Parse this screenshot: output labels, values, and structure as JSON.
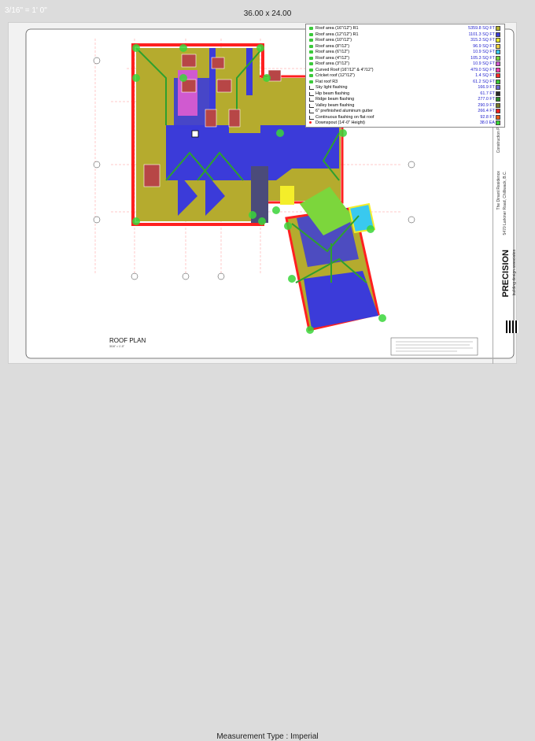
{
  "viewer": {
    "scale_label": "3/16\" = 1' 0\"",
    "sheet_size": "36.00 x 24.00",
    "measurement_type": "Measurement Type : Imperial"
  },
  "legend": [
    {
      "label": "Roof area (16\"/12\") R1",
      "value": "5359.8 SQ FT",
      "color": "#b5b230",
      "icon": "area"
    },
    {
      "label": "Roof area (12\"/12\") R1",
      "value": "1101.3 SQ FT",
      "color": "#3b3bd9",
      "icon": "area"
    },
    {
      "label": "Roof area (10\"/12\")",
      "value": "315.3 SQ FT",
      "color": "#e8e826",
      "icon": "area"
    },
    {
      "label": "Roof area (8\"/12\")",
      "value": "96.9 SQ FT",
      "color": "#f0d040",
      "icon": "area"
    },
    {
      "label": "Roof area (6\"/12\")",
      "value": "10.9 SQ FT",
      "color": "#39c9ef",
      "icon": "area"
    },
    {
      "label": "Roof area (4\"/12\")",
      "value": "105.3 SQ FT",
      "color": "#7cd63c",
      "icon": "area"
    },
    {
      "label": "Roof area (3\"/12\")",
      "value": "10.9 SQ FT",
      "color": "#d05ad0",
      "icon": "area"
    },
    {
      "label": "Curved Roof (16\"/12\" & 4\"/12\")",
      "value": "479.0 SQ FT",
      "color": "#ff3fb0",
      "icon": "area"
    },
    {
      "label": "Cricket roof (12\"/12\")",
      "value": "1.4 SQ FT",
      "color": "#ff2a2a",
      "icon": "area"
    },
    {
      "label": "Flat roof R3",
      "value": "61.2 SQ FT",
      "color": "#3ac93a",
      "icon": "area"
    },
    {
      "label": "Sky light flashing",
      "value": "166.9 FT",
      "color": "#6a6ad0",
      "icon": "line"
    },
    {
      "label": "Hip beam flashing",
      "value": "61.7 FT",
      "color": "#2a2a2a",
      "icon": "line"
    },
    {
      "label": "Ridge beam flashing",
      "value": "277.0 FT",
      "color": "#2a8a2a",
      "icon": "line"
    },
    {
      "label": "Valley beam  flashing",
      "value": "290.9 FT",
      "color": "#7a7a2a",
      "icon": "line"
    },
    {
      "label": "6\" prefinished aluminum gutter",
      "value": "266.4 FT",
      "color": "#ff2020",
      "icon": "line"
    },
    {
      "label": "Continuous flashing on flat roof",
      "value": "92.8 FT",
      "color": "#e85a1a",
      "icon": "line"
    },
    {
      "label": "Downspout (14'-0\" Height)",
      "value": "38.0 EA",
      "color": "#3ad63a",
      "icon": "dot"
    }
  ],
  "drawing": {
    "plan_title": "ROOF PLAN",
    "plan_scale": "3/16\" = 1'-0\"",
    "grid_left": [
      "A",
      "B",
      "C",
      "D",
      "E",
      "F",
      "G"
    ],
    "grid_top": [
      "1",
      "2",
      "3",
      "4",
      "5",
      "6",
      "7"
    ]
  },
  "title_block": {
    "company": "PRECISION",
    "tagline": "building design associates",
    "project": "The Dinant Residence",
    "address": "5470 Larkiner Road, Chilliwack, B.C.",
    "sheet_title": "Construction Permit Roof Plan",
    "sheet_no": "A9"
  }
}
